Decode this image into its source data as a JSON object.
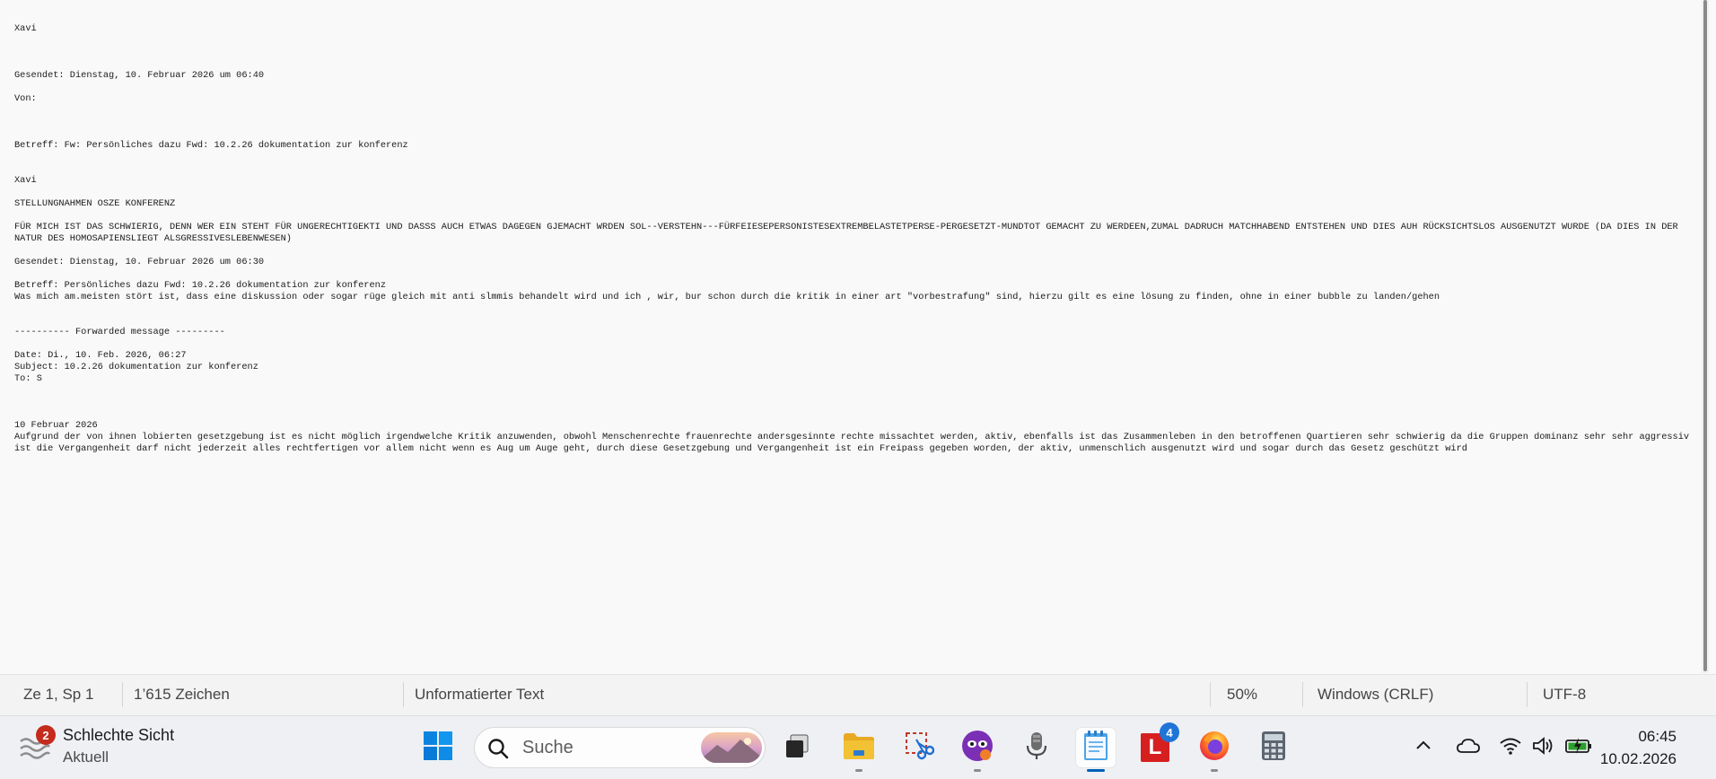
{
  "document": {
    "lines": [
      "Xavi",
      "",
      "",
      "",
      "Gesendet: Dienstag, 10. Februar 2026 um 06:40",
      "",
      "Von:",
      "",
      "",
      "",
      "Betreff: Fw: Persönliches dazu Fwd: 10.2.26 dokumentation zur konferenz",
      "",
      "",
      "Xavi",
      "",
      "STELLUNGNAHMEN OSZE KONFERENZ",
      "",
      "FÜR MICH IST DAS SCHWIERIG, DENN WER EIN STEHT FÜR UNGERECHTIGEKTI UND DASSS AUCH ETWAS DAGEGEN GJEMACHT WRDEN SOL--VERSTEHN---FÜRFEIESEPERSONISTESEXTREMBELASTETPERSE-PERGESETZT-MUNDTOT GEMACHT ZU WERDEEN,ZUMAL DADRUCH MATCHHABEND ENTSTEHEN UND DIES AUH RÜCKSICHTSLOS AUSGENUTZT WURDE (DA DIES IN DER NATUR DES HOMOSAPIENSLIEGT ALSGRESSIVESLEBENWESEN)",
      "",
      "Gesendet: Dienstag, 10. Februar 2026 um 06:30",
      "",
      "Betreff: Persönliches dazu Fwd: 10.2.26 dokumentation zur konferenz",
      "Was mich am.meisten stört ist, dass eine diskussion oder sogar rüge gleich mit anti slmmis behandelt wird und ich , wir, bur schon durch die kritik in einer art \"vorbestrafung\" sind, hierzu gilt es eine lösung zu finden, ohne in einer bubble zu landen/gehen",
      "",
      "",
      "---------- Forwarded message ---------",
      "",
      "Date: Di., 10. Feb. 2026, 06:27",
      "Subject: 10.2.26 dokumentation zur konferenz",
      "To: S",
      "",
      "",
      "",
      "10 Februar 2026",
      "Aufgrund der von ihnen lobierten gesetzgebung ist es nicht möglich irgendwelche Kritik anzuwenden, obwohl Menschenrechte frauenrechte andersgesinnte rechte missachtet werden, aktiv, ebenfalls ist das Zusammenleben in den betroffenen Quartieren sehr schwierig da die Gruppen dominanz sehr sehr aggressiv ist die Vergangenheit darf nicht jederzeit alles rechtfertigen vor allem nicht wenn es Aug um Auge geht, durch diese Gesetzgebung und Vergangenheit ist ein Freipass gegeben worden, der aktiv, unmenschlich ausgenutzt wird und sogar durch das Gesetz geschützt wird"
    ]
  },
  "statusbar": {
    "position": "Ze 1, Sp 1",
    "char_count": "1’615 Zeichen",
    "format": "Unformatierter Text",
    "zoom": "50%",
    "line_ending": "Windows (CRLF)",
    "encoding": "UTF-8"
  },
  "taskbar": {
    "weather": {
      "title": "Schlechte Sicht",
      "subtitle": "Aktuell",
      "badge": "2",
      "icon": "fog-icon"
    },
    "search": {
      "placeholder": "Suche"
    },
    "apps": [
      {
        "name": "start",
        "icon": "windows-logo-icon"
      },
      {
        "name": "task-view",
        "icon": "task-view-icon"
      },
      {
        "name": "file-explorer",
        "icon": "folder-icon"
      },
      {
        "name": "snipping-tool",
        "icon": "scissors-icon"
      },
      {
        "name": "masked-app",
        "icon": "mask-icon"
      },
      {
        "name": "microphone-app",
        "icon": "microphone-icon"
      },
      {
        "name": "notepad",
        "icon": "notepad-icon"
      },
      {
        "name": "l-app",
        "icon": "letter-l-icon",
        "badge": "4",
        "letter": "L"
      },
      {
        "name": "firefox",
        "icon": "firefox-icon"
      },
      {
        "name": "calculator",
        "icon": "calculator-icon"
      }
    ],
    "clock": {
      "time": "06:45",
      "date": "10.02.2026"
    }
  },
  "colors": {
    "accent": "#005fb8",
    "badge_red": "#c42b1c",
    "l_app_red": "#d62020",
    "badge_blue": "#1f74d8",
    "folder_yellow": "#f2c134",
    "battery_green": "#2c9f2c"
  }
}
